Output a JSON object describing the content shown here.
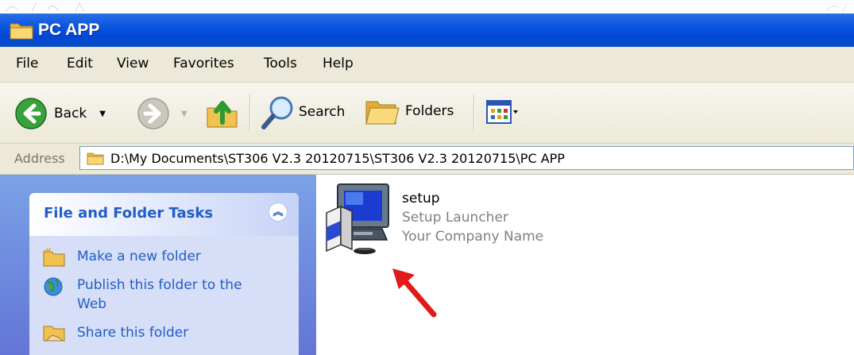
{
  "window": {
    "title": "PC APP"
  },
  "menu": [
    "File",
    "Edit",
    "View",
    "Favorites",
    "Tools",
    "Help"
  ],
  "toolbar": {
    "back_label": "Back",
    "search_label": "Search",
    "folders_label": "Folders"
  },
  "address": {
    "label": "Address",
    "path": "D:\\My Documents\\ST306 V2.3 20120715\\ST306 V2.3 20120715\\PC APP"
  },
  "tasks": {
    "title": "File and Folder Tasks",
    "items": [
      {
        "label": "Make a new folder",
        "icon": "new-folder-icon"
      },
      {
        "label": "Publish this folder to the Web",
        "icon": "publish-web-icon"
      },
      {
        "label": "Share this folder",
        "icon": "share-folder-icon"
      }
    ]
  },
  "file": {
    "name": "setup",
    "description": "Setup Launcher",
    "company": "Your Company Name"
  },
  "colors": {
    "title_bar": "#0a55df",
    "task_pane": "#6f8fe0",
    "task_link": "#215dc6",
    "annotation_arrow": "#e21a1a"
  }
}
